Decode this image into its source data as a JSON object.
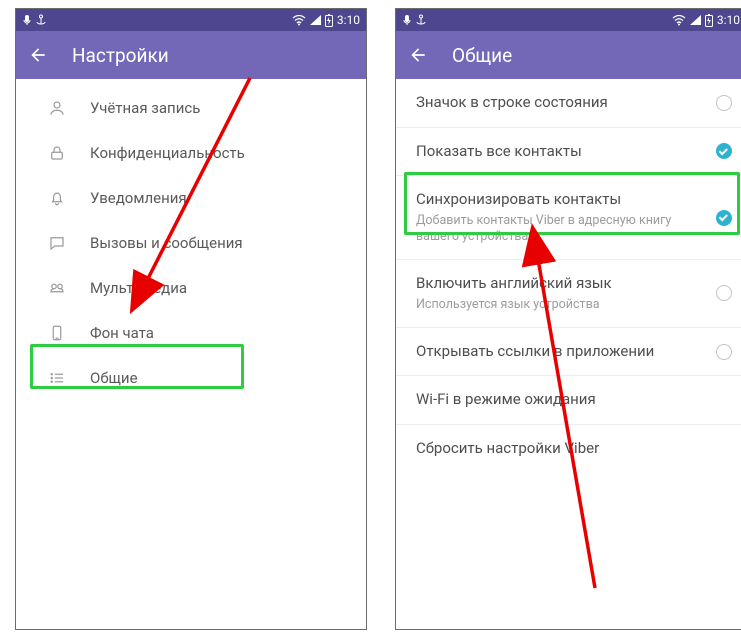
{
  "status": {
    "time": "3:10"
  },
  "left": {
    "header_title": "Настройки",
    "items": [
      {
        "label": "Учётная запись"
      },
      {
        "label": "Конфиденциальность"
      },
      {
        "label": "Уведомления"
      },
      {
        "label": "Вызовы и сообщения"
      },
      {
        "label": "Мультимедиа"
      },
      {
        "label": "Фон чата"
      },
      {
        "label": "Общие"
      }
    ]
  },
  "right": {
    "header_title": "Общие",
    "items": [
      {
        "title": "Значок в строке состояния",
        "subtitle": "",
        "radio": "off"
      },
      {
        "title": "Показать все контакты",
        "subtitle": "",
        "radio": "on"
      },
      {
        "title": "Синхронизировать контакты",
        "subtitle": "Добавить контакты Viber в адресную книгу вашего устройства",
        "radio": "on"
      },
      {
        "title": "Включить английский язык",
        "subtitle": "Используется язык устройства",
        "radio": "off"
      },
      {
        "title": "Открывать ссылки в приложении",
        "subtitle": "",
        "radio": "off"
      },
      {
        "title": "Wi-Fi в режиме ожидания",
        "subtitle": "",
        "radio": ""
      },
      {
        "title": "Сбросить настройки Viber",
        "subtitle": "",
        "radio": ""
      }
    ]
  },
  "colors": {
    "header": "#7367b7",
    "status": "#4f4690",
    "highlight": "#2ecc40",
    "arrow": "#e80000",
    "toggle_on": "#2db3d1"
  }
}
